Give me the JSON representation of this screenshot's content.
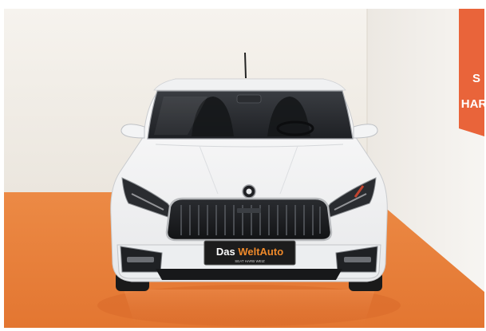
{
  "photo": {
    "description_alt": "",
    "plate": {
      "brand_plain": "Das ",
      "brand_accent": "WeltAuto",
      "dealer_line": "SEAT HARB WEIZ",
      "small_left": "",
      "small_right": ""
    },
    "wall_sign": {
      "line1": "S",
      "line2": "HAR"
    },
    "colors": {
      "floor": "#e8803a",
      "wall": "#f2efea",
      "car_body": "#f4f5f6",
      "sign": "#e9643a",
      "plate_bg": "#1c1c1c",
      "plate_accent": "#f08a2a"
    }
  }
}
